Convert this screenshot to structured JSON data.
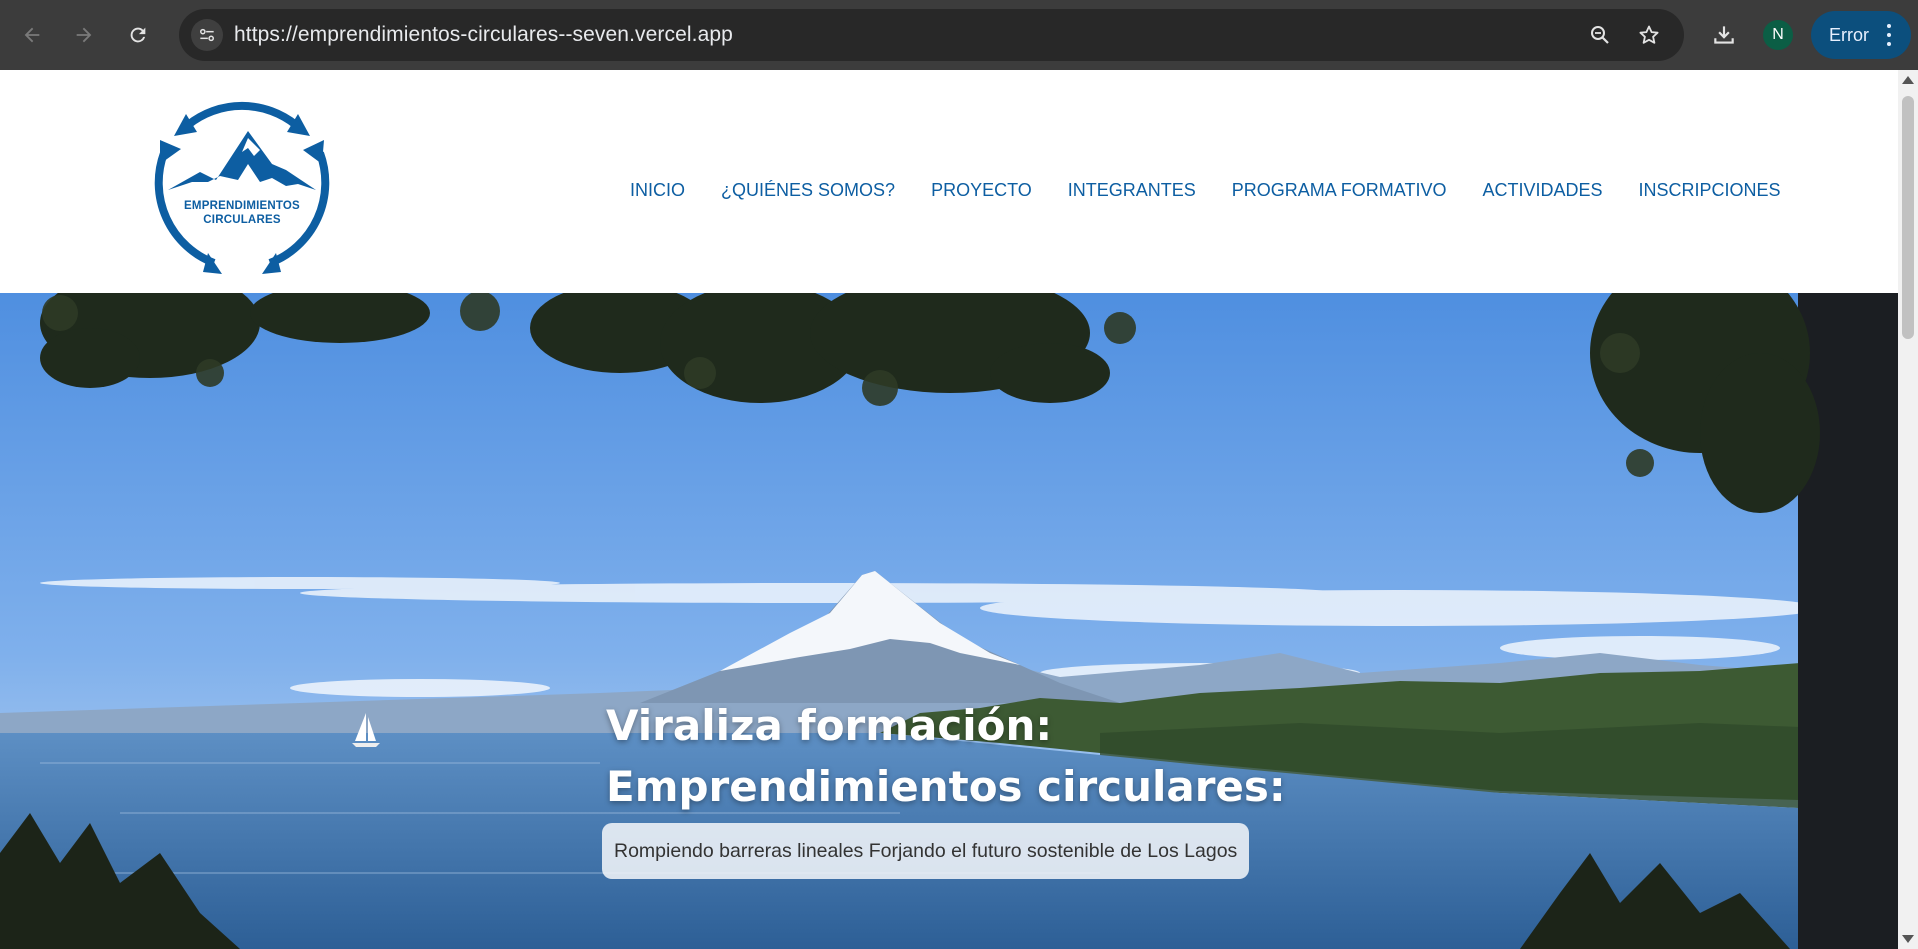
{
  "browser": {
    "url": "https://emprendimientos-circulares--seven.vercel.app",
    "profile_initial": "N",
    "error_label": "Error",
    "icons": {
      "back": "arrow-left-icon",
      "forward": "arrow-right-icon",
      "reload": "reload-icon",
      "site_info": "tune-icon",
      "zoom": "zoom-icon",
      "bookmark": "star-icon",
      "download": "download-icon",
      "menu": "kebab-menu-icon"
    }
  },
  "site": {
    "logo_text_line1": "EMPRENDIMIENTOS",
    "logo_text_line2": "CIRCULARES",
    "brand_color": "#0d5ea2",
    "nav": [
      {
        "label": "INICIO"
      },
      {
        "label": "¿QUIÉNES SOMOS?"
      },
      {
        "label": "PROYECTO"
      },
      {
        "label": "INTEGRANTES"
      },
      {
        "label": "PROGRAMA FORMATIVO"
      },
      {
        "label": "ACTIVIDADES"
      },
      {
        "label": "INSCRIPCIONES"
      }
    ]
  },
  "hero": {
    "title_line1": "Viraliza formación:",
    "title_line2": "Emprendimientos circulares:",
    "subtitle": "Rompiendo barreras lineales Forjando el futuro sostenible de Los Lagos"
  }
}
